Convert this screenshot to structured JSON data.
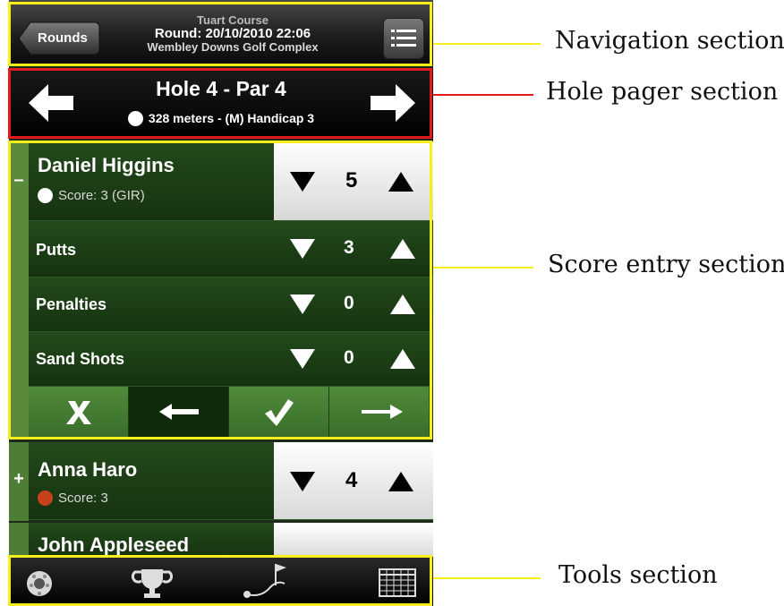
{
  "nav": {
    "back_label": "Rounds",
    "course": "Tuart Course",
    "round": "Round: 20/10/2010 22:06",
    "venue": "Wembley Downs Golf Complex",
    "menu_icon": "list-menu-icon"
  },
  "hole": {
    "title": "Hole 4 - Par 4",
    "info": "328 meters - (M) Handicap 3"
  },
  "players": [
    {
      "name": "Daniel  Higgins",
      "score_text": "Score: 3  (GIR)",
      "strokes": "5",
      "ball_color": "#ffffff",
      "expanded": true,
      "toggle": "–",
      "stats": [
        {
          "label": "Putts",
          "value": "3"
        },
        {
          "label": "Penalties",
          "value": "0"
        },
        {
          "label": "Sand Shots",
          "value": "0"
        }
      ]
    },
    {
      "name": "Anna Haro",
      "score_text": "Score: 3",
      "strokes": "4",
      "ball_color": "#c8401c",
      "expanded": false,
      "toggle": "+"
    },
    {
      "name": "John Appleseed",
      "expanded": false
    }
  ],
  "actions": [
    {
      "name": "clear",
      "glyph": "✘"
    },
    {
      "name": "previous",
      "glyph": "←"
    },
    {
      "name": "confirm",
      "glyph": "✔"
    },
    {
      "name": "next",
      "glyph": "→"
    }
  ],
  "tools": [
    "golf-ball-icon",
    "trophy-icon",
    "course-map-icon",
    "scorecard-grid-icon"
  ],
  "callouts": {
    "navigation": "Navigation section",
    "hole_pager": "Hole pager section",
    "score_entry": "Score entry section",
    "tools": "Tools section"
  },
  "colors": {
    "yellow_highlight": "#f6ef1c",
    "red_highlight": "#e11b1b",
    "row_green": "#1d3d16",
    "side_bar_green": "#5a8a3c"
  }
}
